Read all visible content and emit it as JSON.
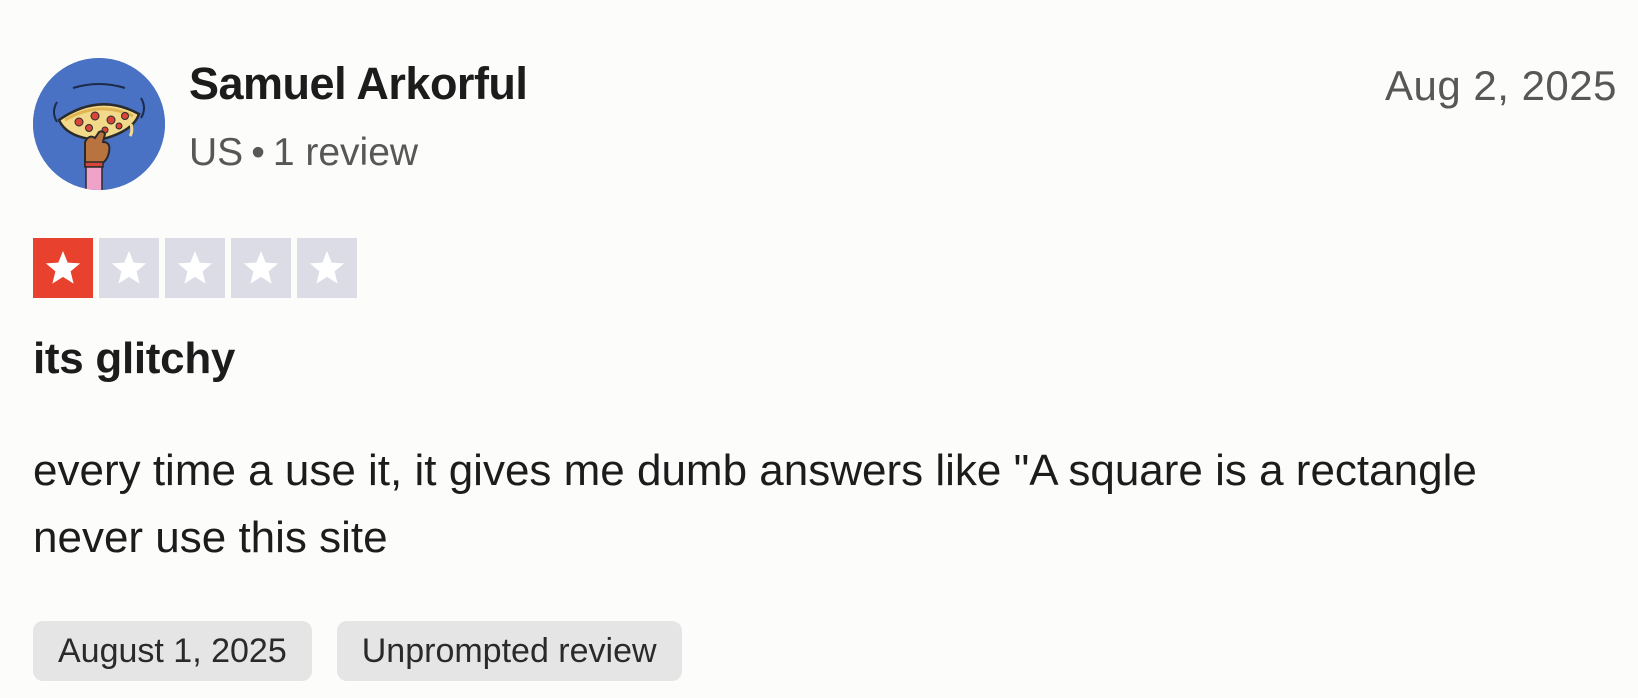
{
  "reviewer": {
    "name": "Samuel Arkorful",
    "country": "US",
    "separator": "•",
    "review_count": "1 review",
    "avatar_icon": "pizza-hand-avatar-icon"
  },
  "review": {
    "date": "Aug 2, 2025",
    "rating": 1,
    "rating_max": 5,
    "title": "its glitchy",
    "body": "every time a use it, it gives me dumb answers like \"A square is a rectangle never use this site",
    "tags": {
      "experience_date": "August 1, 2025",
      "review_type": "Unprompted review"
    }
  },
  "colors": {
    "star_filled": "#e8412d",
    "star_empty": "#dcdce6",
    "avatar_bg": "#4a72c4",
    "tag_bg": "#e5e5e5"
  }
}
